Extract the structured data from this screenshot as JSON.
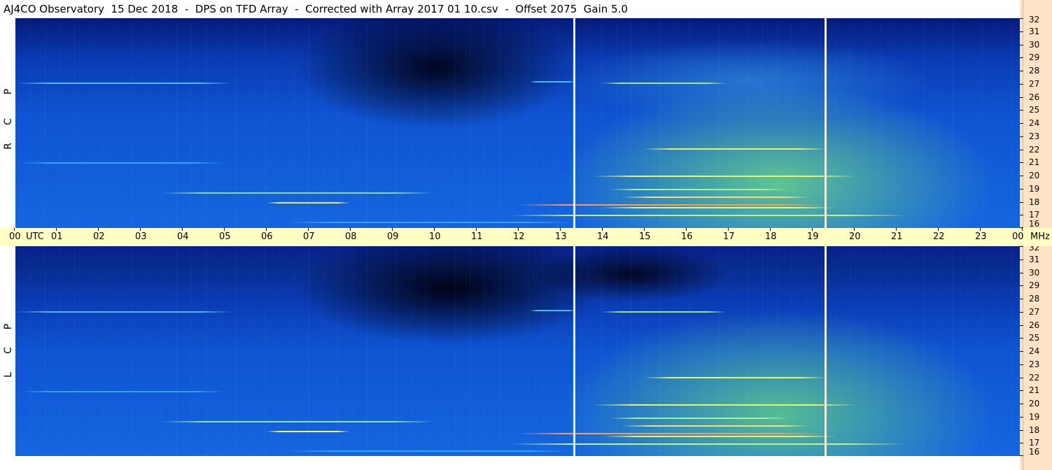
{
  "title": "AJ4CO Observatory  15 Dec 2018  -  DPS on TFD Array  -  Corrected with Array 2017 01 10.csv  -  Offset 2075  Gain 5.0",
  "chart_data": {
    "type": "heatmap",
    "title": "AJ4CO Observatory  15 Dec 2018  -  DPS on TFD Array  -  Corrected with Array 2017 01 10.csv  -  Offset 2075  Gain 5.0",
    "xlabel": "UTC",
    "ylabel": "MHz",
    "xlim": [
      0,
      24
    ],
    "ylim": [
      16,
      32
    ],
    "x_tick_labels": [
      "00",
      "01",
      "02",
      "03",
      "04",
      "05",
      "06",
      "07",
      "08",
      "09",
      "10",
      "11",
      "12",
      "13",
      "14",
      "15",
      "16",
      "17",
      "18",
      "19",
      "20",
      "21",
      "22",
      "23",
      "00"
    ],
    "y_tick_labels": [
      "16",
      "17",
      "18",
      "19",
      "20",
      "21",
      "22",
      "23",
      "24",
      "25",
      "26",
      "27",
      "28",
      "29",
      "30",
      "31",
      "32"
    ],
    "panels": [
      {
        "name": "R C P",
        "letters": [
          "R",
          "C",
          "P"
        ]
      },
      {
        "name": "L C P",
        "letters": [
          "L",
          "C",
          "P"
        ]
      }
    ],
    "gaps_utc": [
      13.35,
      19.35
    ],
    "colormap": [
      "#000014",
      "#061a78",
      "#0f54d2",
      "#1f8cf0",
      "#4fc8e8",
      "#9be887",
      "#f0f06a",
      "#ff6a3a"
    ],
    "grid": false
  },
  "colors": {
    "background": "#ffffff",
    "time_axis_bg": "#ffffc4",
    "freq_axis_bg": "#ffe3c7",
    "gap_line": "#f4f2e4"
  }
}
